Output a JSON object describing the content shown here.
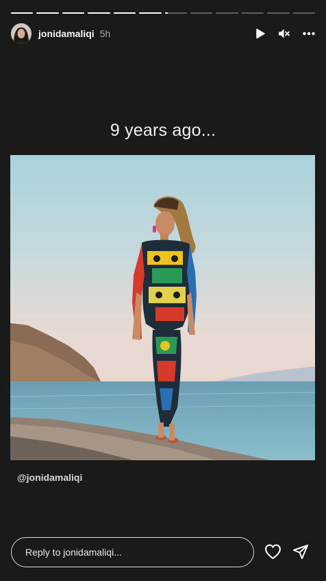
{
  "story": {
    "segments_total": 12,
    "segments_seen": 6,
    "current_segment_progress": 0.15
  },
  "header": {
    "username": "jonidamaliqi",
    "time_ago": "5h",
    "play_icon": "play-icon",
    "mute_icon": "speaker-muted-icon",
    "more_icon": "more-horizontal-icon"
  },
  "content": {
    "headline": "9 years ago...",
    "credit": "@jonidamaliqi"
  },
  "reply": {
    "placeholder": "Reply to jonidamaliqi...",
    "like_icon": "heart-icon",
    "share_icon": "send-icon"
  },
  "colors": {
    "background": "#1a1a1a",
    "progress_active": "#ffffff",
    "progress_inactive": "rgba(255,255,255,0.3)"
  }
}
